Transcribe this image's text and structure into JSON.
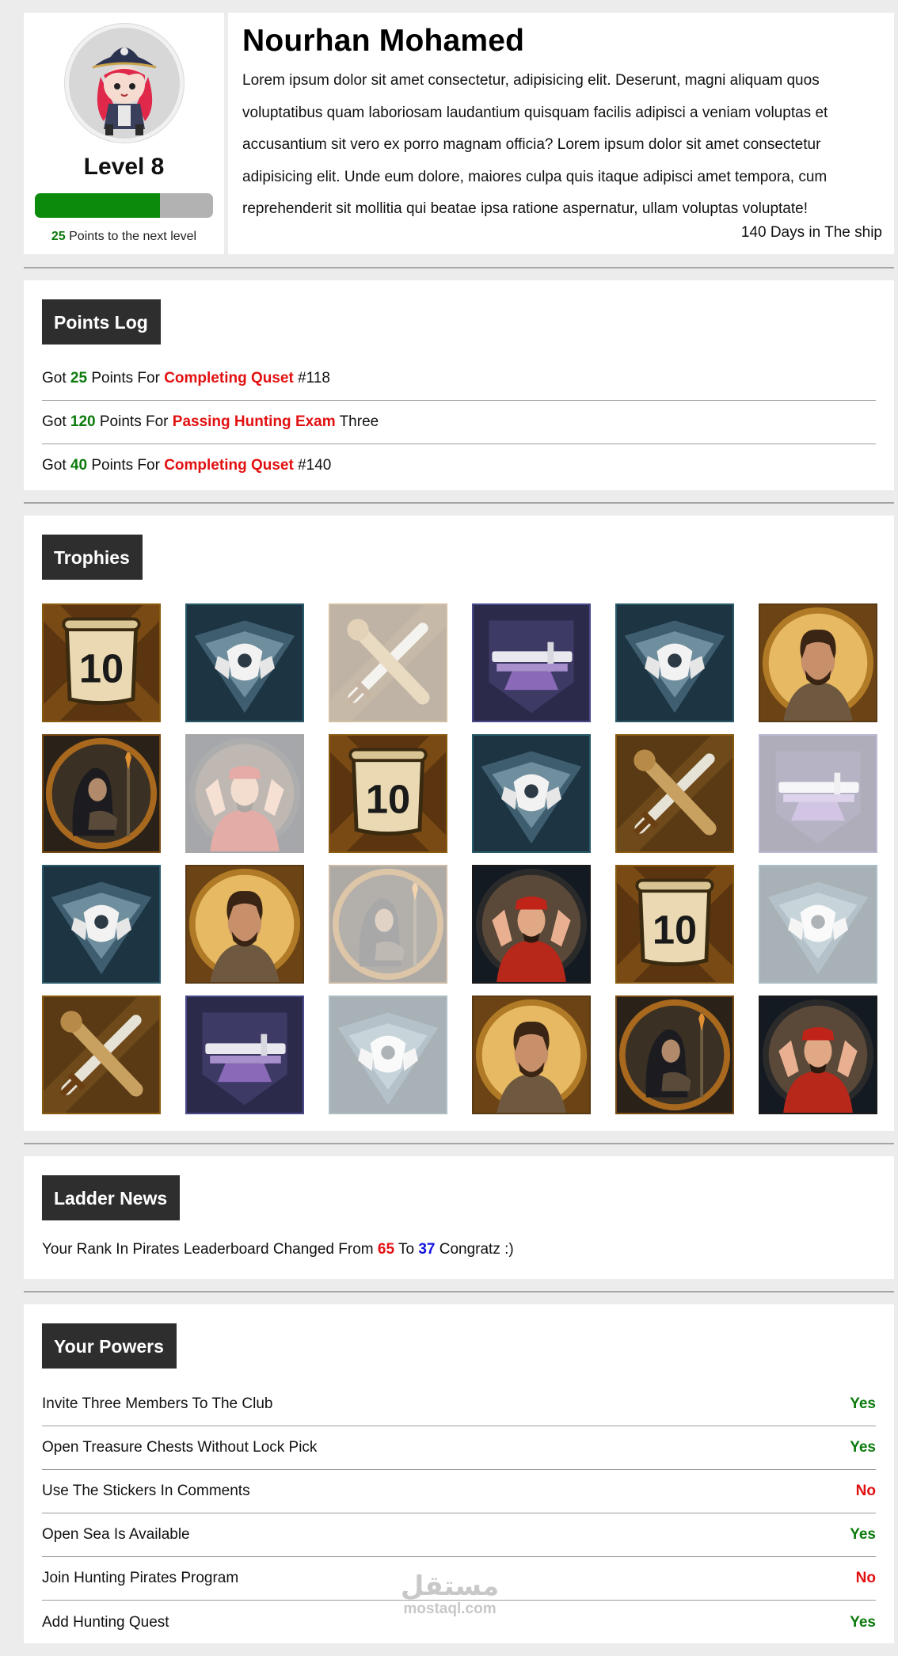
{
  "profile": {
    "name": "Nourhan Mohamed",
    "level_label": "Level 8",
    "progress_fraction": 0.7,
    "points_to_next": "25",
    "points_to_next_suffix": " Points to the next level",
    "bio": "Lorem ipsum dolor sit amet consectetur, adipisicing elit. Deserunt, magni aliquam quos voluptatibus quam laboriosam laudantium quisquam facilis adipisci a veniam voluptas et accusantium sit vero ex porro magnam officia? Lorem ipsum dolor sit amet consectetur adipisicing elit. Unde eum dolore, maiores culpa quis itaque adipisci amet tempora, cum reprehenderit sit mollitia qui beatae ipsa ratione aspernatur, ullam voluptas voluptate!",
    "days": "140 Days in The ship",
    "avatar_icon": "pirate-girl-avatar"
  },
  "points_log": {
    "title": "Points Log",
    "items": [
      {
        "prefix": "Got ",
        "points": "25",
        "mid": " Points For ",
        "reason": "Completing Quset",
        "suffix": " #118"
      },
      {
        "prefix": "Got ",
        "points": "120",
        "mid": " Points For ",
        "reason": "Passing Hunting Exam",
        "suffix": " Three"
      },
      {
        "prefix": "Got ",
        "points": "40",
        "mid": " Points For ",
        "reason": "Completing Quset",
        "suffix": " #140"
      }
    ]
  },
  "trophies": {
    "title": "Trophies",
    "items": [
      {
        "icon": "scroll-10-icon",
        "faded": false
      },
      {
        "icon": "shield-crest-icon",
        "faded": false
      },
      {
        "icon": "crossed-swords-icon",
        "faded": true
      },
      {
        "icon": "sword-anvil-icon",
        "faded": false
      },
      {
        "icon": "shield-crest-icon",
        "faded": false
      },
      {
        "icon": "bearded-man-portrait-icon",
        "faded": false
      },
      {
        "icon": "hooded-woman-portrait-icon",
        "faded": false
      },
      {
        "icon": "red-robed-man-portrait-icon",
        "faded": true
      },
      {
        "icon": "scroll-10-icon",
        "faded": false
      },
      {
        "icon": "shield-crest-icon",
        "faded": false
      },
      {
        "icon": "crossed-swords-icon",
        "faded": false
      },
      {
        "icon": "sword-anvil-icon",
        "faded": true
      },
      {
        "icon": "shield-crest-icon",
        "faded": false
      },
      {
        "icon": "bearded-man-portrait-icon",
        "faded": false
      },
      {
        "icon": "hooded-woman-portrait-icon",
        "faded": true
      },
      {
        "icon": "red-robed-man-portrait-icon",
        "faded": false
      },
      {
        "icon": "scroll-10-icon",
        "faded": false
      },
      {
        "icon": "shield-crest-icon",
        "faded": true
      },
      {
        "icon": "crossed-swords-icon",
        "faded": false
      },
      {
        "icon": "sword-anvil-icon",
        "faded": false
      },
      {
        "icon": "shield-crest-icon",
        "faded": true
      },
      {
        "icon": "bearded-man-portrait-icon",
        "faded": false
      },
      {
        "icon": "hooded-woman-portrait-icon",
        "faded": false
      },
      {
        "icon": "red-robed-man-portrait-icon",
        "faded": false
      }
    ]
  },
  "ladder": {
    "title": "Ladder News",
    "prefix": "Your Rank In Pirates Leaderboard Changed From ",
    "from": "65",
    "mid": " To ",
    "to": "37",
    "suffix": " Congratz :)"
  },
  "powers": {
    "title": "Your Powers",
    "items": [
      {
        "label": "Invite Three Members To The Club",
        "value": "Yes"
      },
      {
        "label": "Open Treasure Chests Without Lock Pick",
        "value": "Yes"
      },
      {
        "label": "Use The Stickers In Comments",
        "value": "No"
      },
      {
        "label": "Open Sea Is Available",
        "value": "Yes"
      },
      {
        "label": "Join Hunting Pirates Program",
        "value": "No"
      },
      {
        "label": "Add Hunting Quest",
        "value": "Yes"
      }
    ]
  },
  "watermark": {
    "arabic": "مستقل",
    "latin": "mostaql.com"
  },
  "colors": {
    "green": "#0b8a0b",
    "red": "#e21010",
    "blue": "#1212e0",
    "title_bg": "#2e2e2e"
  }
}
